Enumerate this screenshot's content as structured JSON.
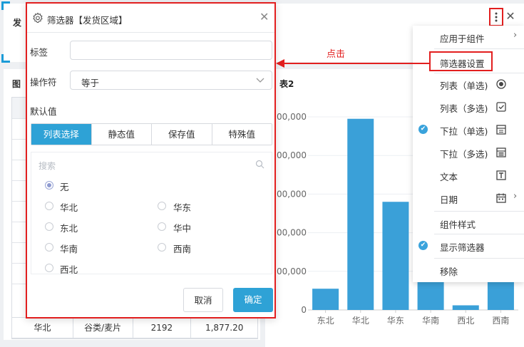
{
  "dashboard": {
    "top_title_fragment": "发",
    "left_title_fragment": "图",
    "right_title_fragment": "表2",
    "table_last_row": [
      "华北",
      "谷类/麦片",
      "2192",
      "1,877.20"
    ]
  },
  "chart_data": {
    "type": "bar",
    "title": "表2",
    "categories": [
      "东北",
      "华北",
      "华东",
      "华南",
      "西北",
      "西南"
    ],
    "values": [
      55000,
      495000,
      280000,
      80000,
      12000,
      80000
    ],
    "ylim": [
      0,
      500000
    ],
    "ytick_labels": [
      "0",
      "00,000",
      "00,000",
      "00,000",
      "00,000",
      "00,000"
    ],
    "bar_color": "#3aa0d8",
    "grid": true
  },
  "toolbar": {
    "more_icon": "more-vertical-icon",
    "close_icon": "close-icon"
  },
  "menu": {
    "items": [
      {
        "label": "应用于组件",
        "arrow": "›"
      },
      {
        "label": "筛选器设置"
      },
      {
        "label": "列表（单选)"
      },
      {
        "label": "列表（多选)"
      },
      {
        "label": "下拉（单选)",
        "checked": true
      },
      {
        "label": "下拉（多选)"
      },
      {
        "label": "文本"
      },
      {
        "label": "日期",
        "arrow": "›"
      },
      {
        "label": "组件样式"
      },
      {
        "label": "显示筛选器",
        "checked": true
      },
      {
        "label": "移除"
      }
    ],
    "check_glyph": "✔"
  },
  "annotation": {
    "click_label": "点击",
    "accent_color": "#e21f1f"
  },
  "dialog": {
    "title": "筛选器【发货区域】",
    "close_glyph": "✕",
    "label_field": "标签",
    "label_value": "",
    "operator_field": "操作符",
    "operator_value": "等于",
    "default_value_label": "默认值",
    "tabs": [
      "列表选择",
      "静态值",
      "保存值",
      "特殊值"
    ],
    "search_placeholder": "搜索",
    "options": [
      "无",
      "华北",
      "华东",
      "东北",
      "华中",
      "华南",
      "西南",
      "西北"
    ],
    "cancel_label": "取消",
    "ok_label": "确定",
    "primary_color": "#2ea2d6"
  }
}
